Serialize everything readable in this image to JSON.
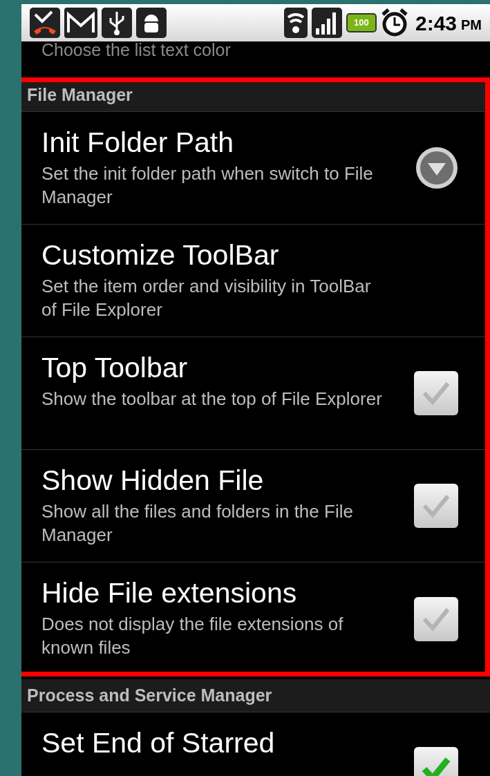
{
  "status_bar": {
    "time": "2:43",
    "ampm": "PM",
    "battery": "100"
  },
  "top_partial": {
    "summary": "Choose the list text color"
  },
  "sections": [
    {
      "title": "File Manager",
      "highlighted": true,
      "items": [
        {
          "title": "Init Folder Path",
          "summary": "Set the init folder path when switch to File Manager",
          "kind": "dropdown"
        },
        {
          "title": "Customize ToolBar",
          "summary": "Set the item order and visibility in ToolBar of File Explorer",
          "kind": "plain"
        },
        {
          "title": "Top Toolbar",
          "summary": "Show the toolbar at the top of File Explorer",
          "kind": "checkbox",
          "checked": false
        },
        {
          "title": "Show Hidden File",
          "summary": "Show all the files and folders in the File Manager",
          "kind": "checkbox",
          "checked": false
        },
        {
          "title": "Hide File extensions",
          "summary": "Does not display the file extensions of known files",
          "kind": "checkbox",
          "checked": false
        }
      ]
    },
    {
      "title": "Process and Service Manager",
      "highlighted": false,
      "items": [
        {
          "title": "Set End of Starred",
          "kind": "checkbox",
          "checked": true
        }
      ]
    }
  ]
}
